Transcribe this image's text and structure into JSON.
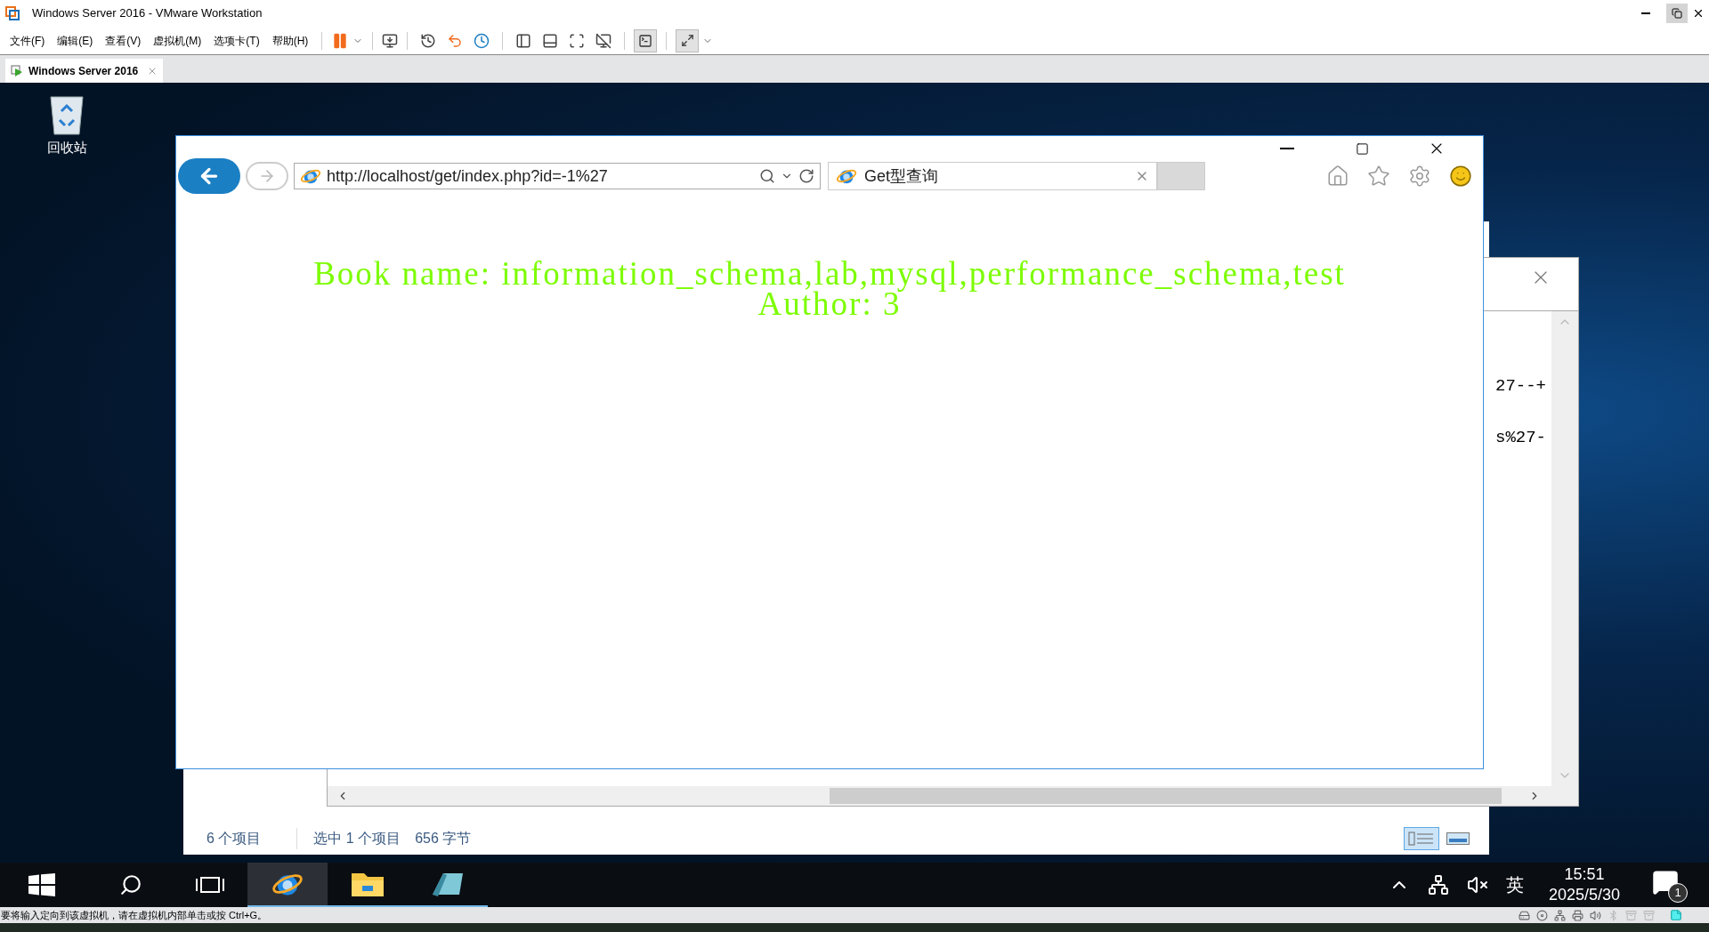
{
  "window": {
    "title": "Windows Server 2016 - VMware Workstation"
  },
  "menu": [
    "文件(F)",
    "编辑(E)",
    "查看(V)",
    "虚拟机(M)",
    "选项卡(T)",
    "帮助(H)"
  ],
  "vm_tabs": [
    {
      "label": "Windows Server 2016",
      "selected": true
    }
  ],
  "desktop_icons": [
    {
      "label": "回收站"
    }
  ],
  "browser": {
    "address": "http://localhost/get/index.php?id=-1%27",
    "tabs": [
      {
        "label": "Get型查询",
        "selected": true
      }
    ],
    "content": [
      "Book name: information_schema,lab,mysql,performance_schema,test",
      "Author: 3"
    ]
  },
  "editor": {
    "lines": [
      "27--+",
      "s%27-"
    ]
  },
  "explorer": {
    "status": [
      "6 个项目",
      "选中 1 个项目",
      "656 字节"
    ]
  },
  "taskbar": {
    "apps": [
      {
        "kind": "browser",
        "active": true
      },
      {
        "kind": "folder",
        "active": false
      },
      {
        "kind": "app",
        "active": false
      }
    ],
    "language": "英",
    "time": "15:51",
    "date": "2025/5/30",
    "notification_count": "1"
  },
  "status_bar": "要将输入定向到该虚拟机，请在虚拟机内部单击或按 Ctrl+G。"
}
